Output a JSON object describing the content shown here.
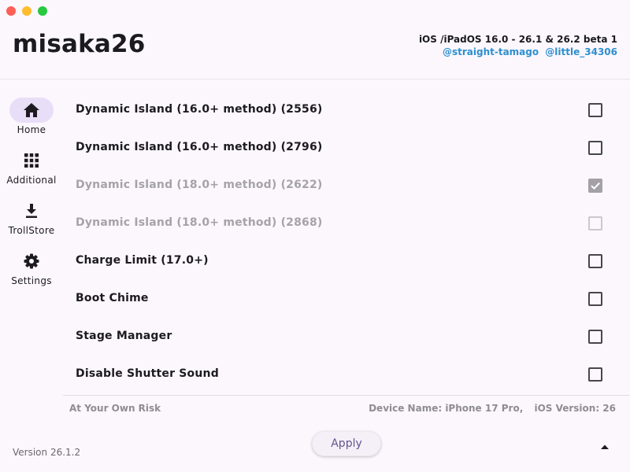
{
  "window": {
    "controls": [
      "close",
      "minimize",
      "maximize"
    ]
  },
  "header": {
    "app_title": "misaka26",
    "ios_range": "iOS /iPadOS 16.0 - 26.1 & 26.2 beta 1",
    "credits": [
      "@straight-tamago",
      "@little_34306"
    ]
  },
  "nav": {
    "items": [
      {
        "label": "Home",
        "icon": "home-icon",
        "active": true
      },
      {
        "label": "Additional",
        "icon": "grid-icon",
        "active": false
      },
      {
        "label": "TrollStore",
        "icon": "download-icon",
        "active": false
      },
      {
        "label": "Settings",
        "icon": "gear-icon",
        "active": false
      }
    ]
  },
  "options": [
    {
      "label": "Dynamic Island (16.0+ method) (2556)",
      "checked": false,
      "enabled": true
    },
    {
      "label": "Dynamic Island (16.0+ method) (2796)",
      "checked": false,
      "enabled": true
    },
    {
      "label": "Dynamic Island (18.0+ method) (2622)",
      "checked": true,
      "enabled": false
    },
    {
      "label": "Dynamic Island (18.0+ method) (2868)",
      "checked": false,
      "enabled": false
    },
    {
      "label": "Charge Limit (17.0+)",
      "checked": false,
      "enabled": true
    },
    {
      "label": "Boot Chime",
      "checked": false,
      "enabled": true
    },
    {
      "label": "Stage Manager",
      "checked": false,
      "enabled": true
    },
    {
      "label": "Disable Shutter Sound",
      "checked": false,
      "enabled": true
    }
  ],
  "footer": {
    "risk": "At Your Own Risk",
    "device_name": "Device Name: iPhone 17 Pro,",
    "ios_version": "iOS Version: 26",
    "version": "Version 26.1.2",
    "apply_label": "Apply"
  },
  "colors": {
    "background": "#fbf7fd",
    "accent": "#65558f",
    "nav_active": "#e8def8",
    "link": "#2e8fcf",
    "disabled_text": "#a5a3a9"
  }
}
